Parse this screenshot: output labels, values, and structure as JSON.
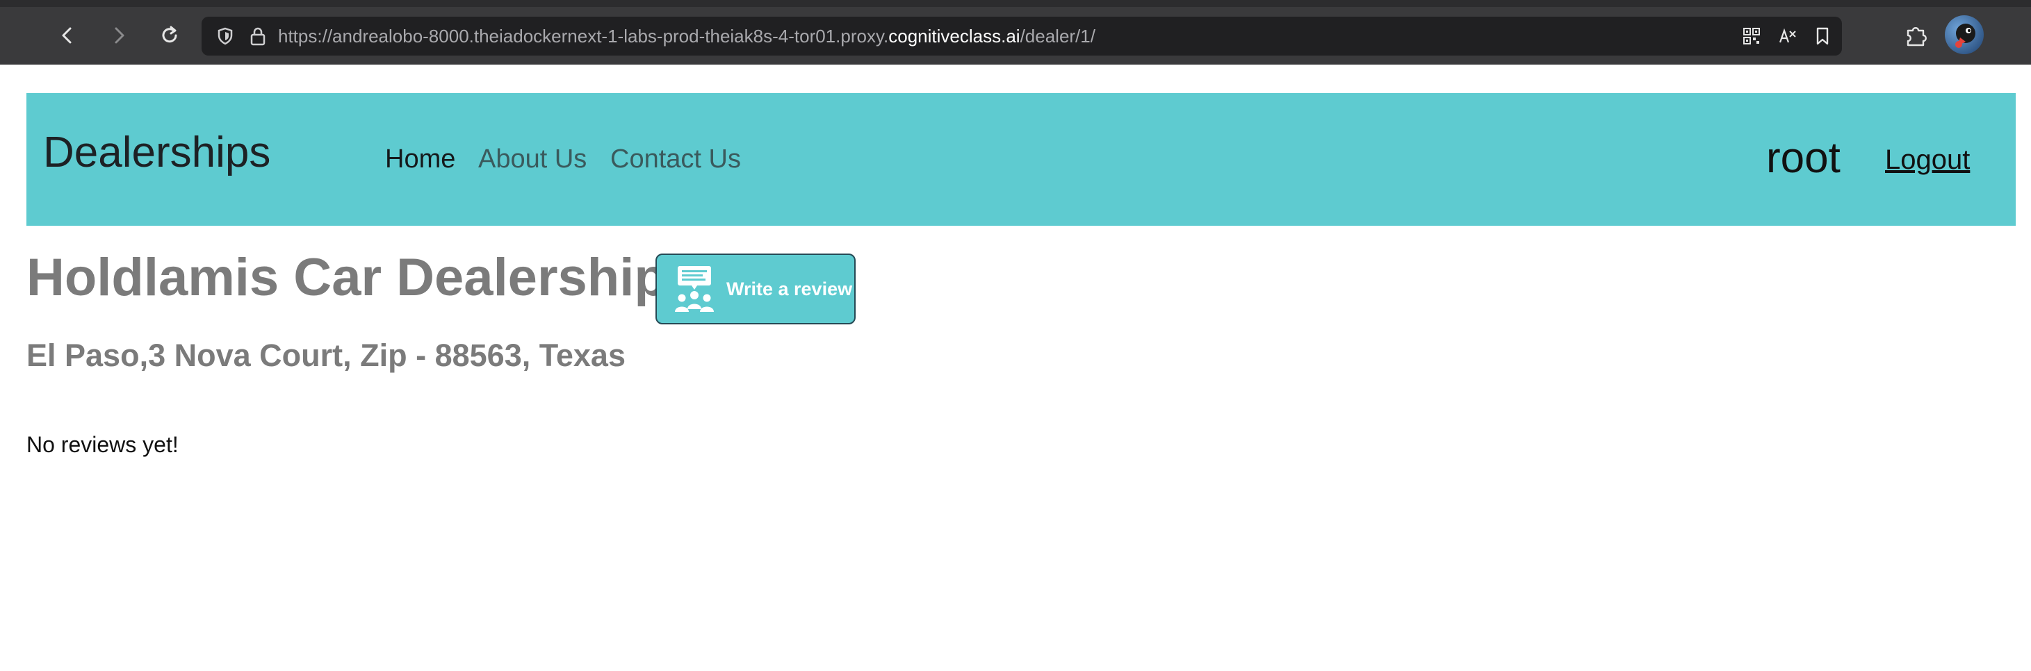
{
  "browser": {
    "url_prefix": "https://andrealobo-8000.theiadockernext-1-labs-prod-theiak8s-4-tor01.proxy.",
    "url_domain": "cognitiveclass.ai",
    "url_path": "/dealer/1/",
    "icons": [
      "back-icon",
      "forward-icon",
      "reload-icon",
      "shield-icon",
      "lock-icon",
      "qr-code-icon",
      "translate-icon",
      "bookmark-icon",
      "extensions-icon"
    ]
  },
  "navbar": {
    "brand": "Dealerships",
    "links": [
      "Home",
      "About Us",
      "Contact Us"
    ],
    "username": "root",
    "logout": "Logout",
    "color": "#5ecbd0"
  },
  "dealer": {
    "name": "Holdlamis Car Dealership",
    "address": "El Paso,3 Nova Court, Zip - 88563, Texas",
    "review_button_label": "Write a review",
    "review_icon": "people-chat-icon"
  },
  "reviews": {
    "empty_message": "No reviews yet!"
  }
}
